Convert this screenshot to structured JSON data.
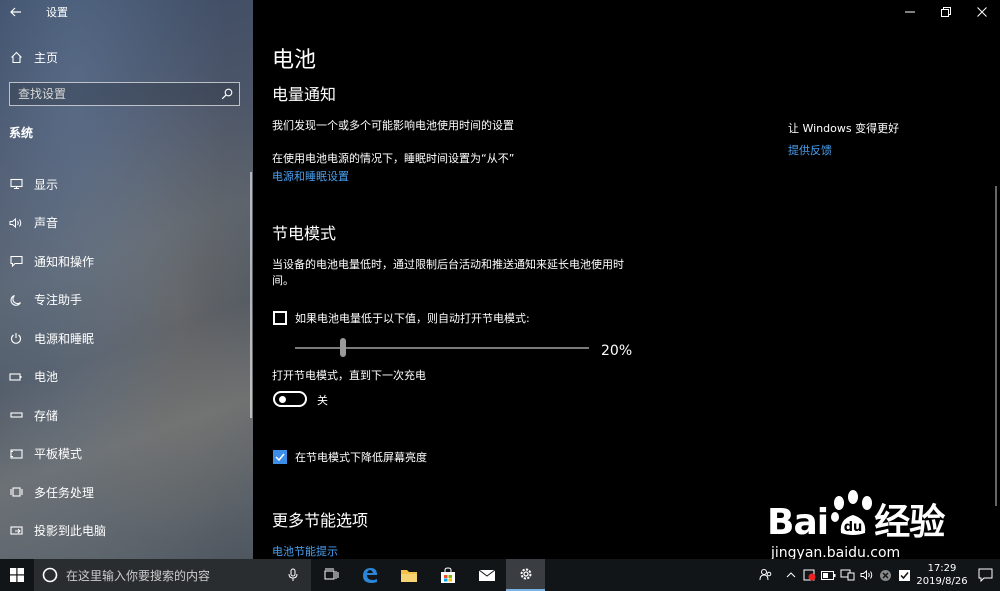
{
  "window": {
    "app_title": "设置"
  },
  "sidebar": {
    "home_label": "主页",
    "search_placeholder": "查找设置",
    "section_title": "系统",
    "items": [
      {
        "label": "显示",
        "icon": "monitor-icon"
      },
      {
        "label": "声音",
        "icon": "speaker-icon"
      },
      {
        "label": "通知和操作",
        "icon": "message-icon"
      },
      {
        "label": "专注助手",
        "icon": "moon-icon"
      },
      {
        "label": "电源和睡眠",
        "icon": "power-icon"
      },
      {
        "label": "电池",
        "icon": "battery-icon",
        "selected": true
      },
      {
        "label": "存储",
        "icon": "storage-icon"
      },
      {
        "label": "平板模式",
        "icon": "tablet-icon"
      },
      {
        "label": "多任务处理",
        "icon": "multitask-icon"
      },
      {
        "label": "投影到此电脑",
        "icon": "project-icon"
      }
    ]
  },
  "main": {
    "page_title": "电池",
    "notification": {
      "heading": "电量通知",
      "text1": "我们发现一个或多个可能影响电池使用时间的设置",
      "text2": "在使用电池电源的情况下，睡眠时间设置为“从不”",
      "link": "电源和睡眠设置"
    },
    "saver": {
      "heading": "节电模式",
      "desc_line1": "当设备的电池电量低时，通过限制后台活动和推送通知来延长电池使用时",
      "desc_line2": "间。",
      "auto_label": "如果电池电量低于以下值，则自动打开节电模式:",
      "auto_checked": false,
      "slider_percent": 20,
      "slider_value": "20%",
      "toggle_caption": "打开节电模式，直到下一次充电",
      "toggle_state": "关",
      "toggle_on": false,
      "brightness_label": "在节电模式下降低屏幕亮度",
      "brightness_checked": true
    },
    "more": {
      "heading": "更多节能选项",
      "link": "电池节能提示"
    },
    "side_panel": {
      "title": "让 Windows 变得更好",
      "link": "提供反馈"
    }
  },
  "watermark": {
    "brand": "Bai  经验",
    "site": "jingyan.baidu.com"
  },
  "taskbar": {
    "search_placeholder": "在这里输入你要搜索的内容",
    "time": "17:29",
    "date": "2019/8/26"
  },
  "colors": {
    "accent": "#3c8ee8",
    "link": "#4aa0f0"
  }
}
